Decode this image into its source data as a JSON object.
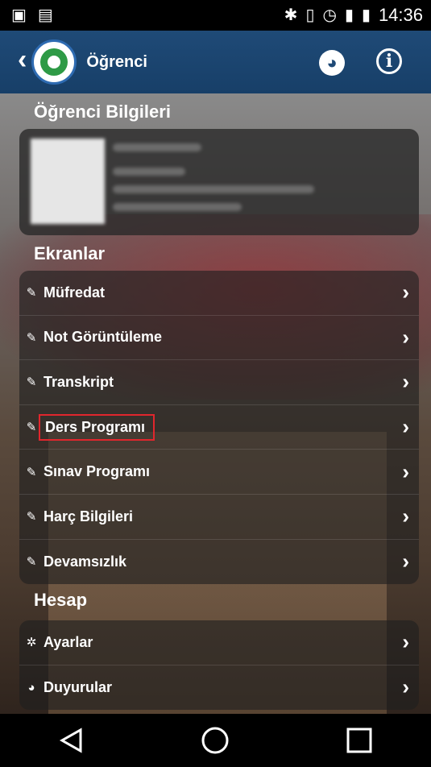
{
  "status_bar": {
    "time": "14:36",
    "left_icons": [
      "image-icon",
      "file-icon"
    ],
    "right_icons": [
      "bluetooth-icon",
      "vibrate-icon",
      "alarm-icon",
      "signal-icon",
      "battery-icon"
    ]
  },
  "app_bar": {
    "title": "Öğrenci",
    "back_icon": "‹",
    "globe_icon": "globe-icon",
    "info_icon": "info-icon"
  },
  "profile": {
    "section_title": "Öğrenci Bilgileri"
  },
  "screens": {
    "section_title": "Ekranlar",
    "items": [
      {
        "label": "Müfredat",
        "icon": "pencil-icon"
      },
      {
        "label": "Not Görüntüleme",
        "icon": "pencil-icon"
      },
      {
        "label": "Transkript",
        "icon": "pencil-icon"
      },
      {
        "label": "Ders Programı",
        "icon": "pencil-icon",
        "highlighted": true
      },
      {
        "label": "Sınav Programı",
        "icon": "pencil-icon"
      },
      {
        "label": "Harç Bilgileri",
        "icon": "pencil-icon"
      },
      {
        "label": "Devamsızlık",
        "icon": "pencil-icon"
      }
    ]
  },
  "account": {
    "section_title": "Hesap",
    "items": [
      {
        "label": "Ayarlar",
        "icon": "gear-icon"
      },
      {
        "label": "Duyurular",
        "icon": "globe-icon"
      }
    ]
  },
  "colors": {
    "app_bar": "#1f4a77",
    "highlight": "#e1262d"
  }
}
